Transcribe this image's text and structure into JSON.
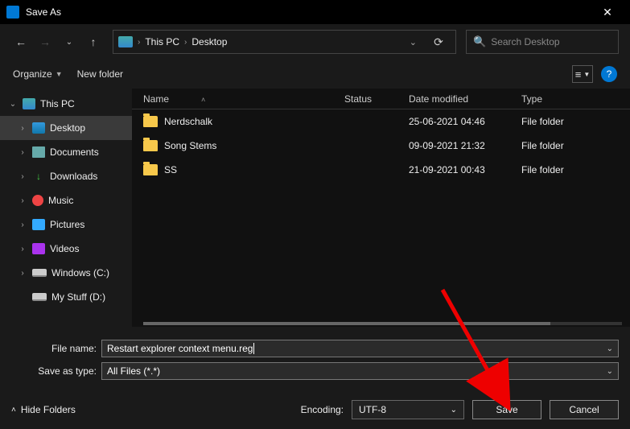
{
  "titlebar": {
    "title": "Save As"
  },
  "breadcrumb": {
    "root": "This PC",
    "current": "Desktop"
  },
  "search": {
    "placeholder": "Search Desktop"
  },
  "toolbar": {
    "organize": "Organize",
    "newfolder": "New folder"
  },
  "sidebar": {
    "root": "This PC",
    "items": [
      {
        "label": "Desktop"
      },
      {
        "label": "Documents"
      },
      {
        "label": "Downloads"
      },
      {
        "label": "Music"
      },
      {
        "label": "Pictures"
      },
      {
        "label": "Videos"
      },
      {
        "label": "Windows (C:)"
      },
      {
        "label": "My Stuff (D:)"
      }
    ]
  },
  "columns": {
    "name": "Name",
    "status": "Status",
    "date": "Date modified",
    "type": "Type"
  },
  "files": [
    {
      "name": "Nerdschalk",
      "date": "25-06-2021 04:46",
      "type": "File folder"
    },
    {
      "name": "Song Stems",
      "date": "09-09-2021 21:32",
      "type": "File folder"
    },
    {
      "name": "SS",
      "date": "21-09-2021 00:43",
      "type": "File folder"
    }
  ],
  "fields": {
    "filename_label": "File name:",
    "filename_value": "Restart explorer context menu.reg",
    "saveastype_label": "Save as type:",
    "saveastype_value": "All Files  (*.*)"
  },
  "footer": {
    "hidefolders": "Hide Folders",
    "encoding_label": "Encoding:",
    "encoding_value": "UTF-8",
    "save": "Save",
    "cancel": "Cancel"
  }
}
